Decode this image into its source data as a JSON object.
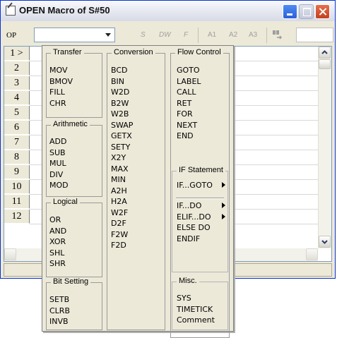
{
  "window": {
    "title": "OPEN Macro of S#50"
  },
  "toolbar": {
    "op_label": "OP",
    "items": [
      "S",
      "DW",
      "F",
      "A1",
      "A2",
      "A3"
    ]
  },
  "rows": [
    "1 >",
    "2",
    "3",
    "4",
    "5",
    "6",
    "7",
    "8",
    "9",
    "10",
    "11",
    "12"
  ],
  "menu": {
    "transfer": {
      "title": "Transfer",
      "items": [
        "MOV",
        "BMOV",
        "FILL",
        "CHR"
      ]
    },
    "arithmetic": {
      "title": "Arithmetic",
      "items": [
        "ADD",
        "SUB",
        "MUL",
        "DIV",
        "MOD"
      ]
    },
    "logical": {
      "title": "Logical",
      "items": [
        "OR",
        "AND",
        "XOR",
        "SHL",
        "SHR"
      ]
    },
    "bitsetting": {
      "title": "Bit Setting",
      "items": [
        "SETB",
        "CLRB",
        "INVB"
      ]
    },
    "conversion": {
      "title": "Conversion",
      "items": [
        "BCD",
        "BIN",
        "W2D",
        "B2W",
        "W2B",
        "SWAP",
        "GETX",
        "SETY",
        "X2Y",
        "MAX",
        "MIN",
        "A2H",
        "H2A",
        "W2F",
        "D2F",
        "F2W",
        "F2D"
      ]
    },
    "flow": {
      "title": "Flow Control",
      "items": [
        "GOTO",
        "LABEL",
        "CALL",
        "RET",
        "FOR",
        "NEXT",
        "END"
      ]
    },
    "ifstmt": {
      "title": "IF Statement",
      "goto": "IF...GOTO",
      "items": [
        "IF...DO",
        "ELIF...DO",
        "ELSE DO",
        "ENDIF"
      ]
    },
    "misc": {
      "title": "Misc.",
      "items": [
        "SYS",
        "TIMETICK",
        "Comment"
      ]
    }
  }
}
